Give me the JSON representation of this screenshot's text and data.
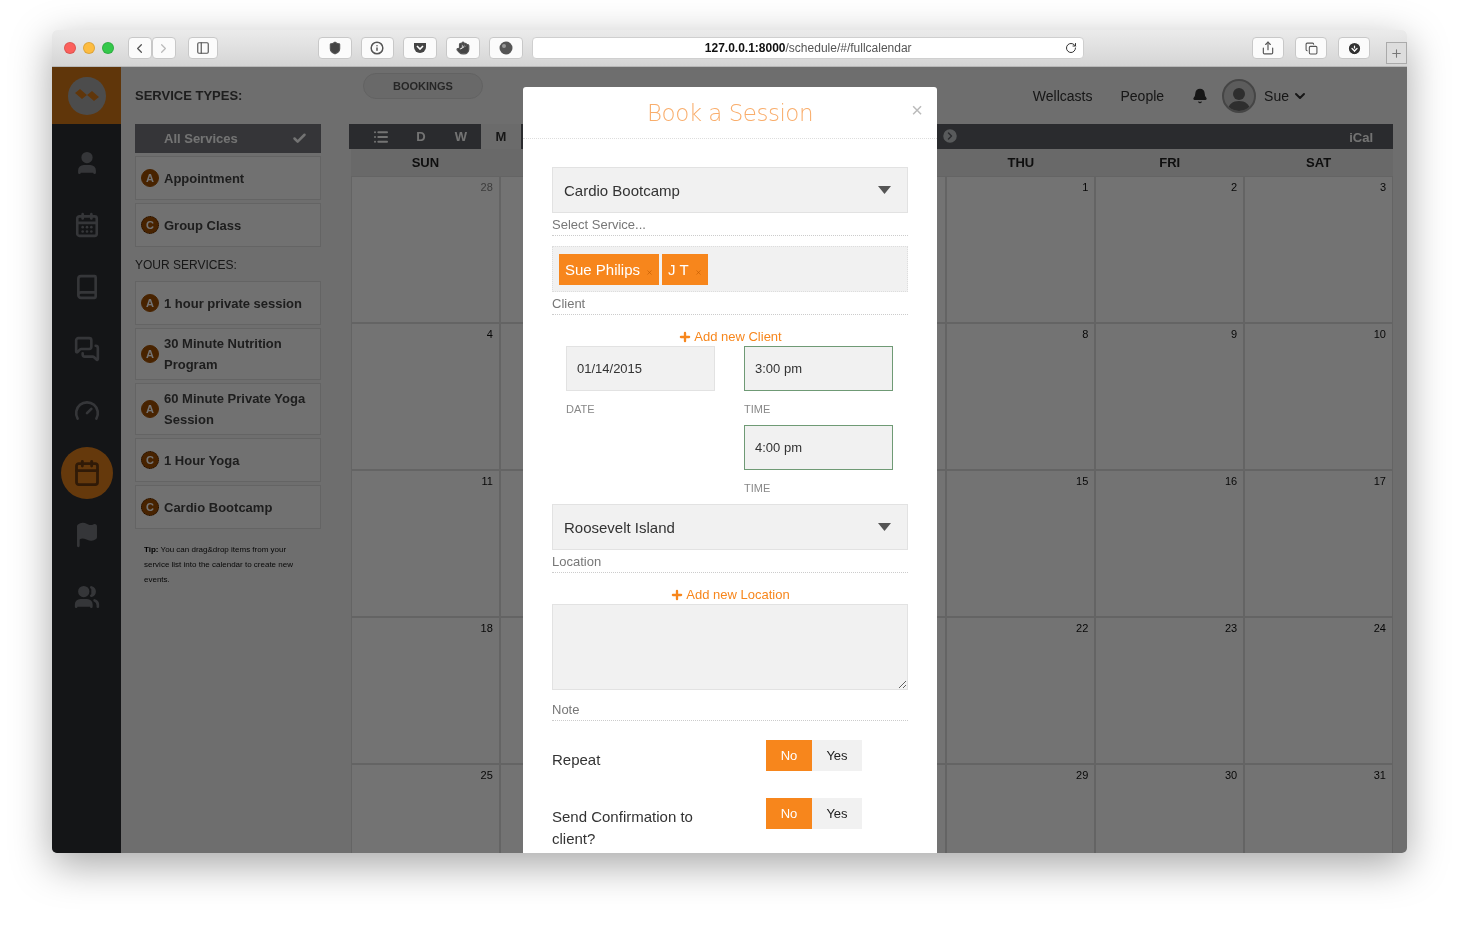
{
  "browser": {
    "url": "**127.0.0.1:8000**/schedule/#/fullcalendar"
  },
  "rail": [
    {
      "kind": "person",
      "selected": false
    },
    {
      "kind": "calendar-wave",
      "selected": false
    },
    {
      "kind": "book",
      "selected": false
    },
    {
      "kind": "chat",
      "selected": false
    },
    {
      "kind": "gauge",
      "selected": false
    },
    {
      "kind": "calendar",
      "selected": true
    },
    {
      "kind": "flag",
      "selected": false
    },
    {
      "kind": "group",
      "selected": false
    }
  ],
  "top_bar": {
    "heading": "SERVICE TYPES:",
    "bookings_button": "BOOKINGS",
    "links": [
      "Wellcasts",
      "People"
    ],
    "user": "Sue"
  },
  "service_types": [
    {
      "kind": "all",
      "label": "All Services",
      "selected": true
    },
    {
      "kind": "appointment",
      "badge": "A",
      "label": "Appointment",
      "selected": false
    },
    {
      "kind": "class",
      "badge": "C",
      "label": "Group Class",
      "selected": false
    }
  ],
  "your_services": {
    "heading": "YOUR SERVICES:",
    "items": [
      {
        "kind": "appointment",
        "badge": "A",
        "label": "1 hour private session"
      },
      {
        "kind": "appointment",
        "badge": "A",
        "label": "30 Minute Nutrition Program"
      },
      {
        "kind": "appointment",
        "badge": "A",
        "label": "60 Minute Private Yoga Session"
      },
      {
        "kind": "class",
        "badge": "C",
        "label": "1 Hour Yoga"
      },
      {
        "kind": "class",
        "badge": "C",
        "label": "Cardio Bootcamp"
      }
    ]
  },
  "tip": "**Tip:** You can drag&drop items from your service list into the calendar to create new events.",
  "calendar": {
    "views": [
      {
        "kind": "list",
        "selected": false
      },
      {
        "kind": "text",
        "label": "D",
        "selected": false
      },
      {
        "kind": "text",
        "label": "W",
        "selected": false
      },
      {
        "kind": "text",
        "label": "M",
        "selected": true
      }
    ],
    "ical": "iCal",
    "columns": [
      {
        "kind": "day",
        "header": "SUN",
        "dates": [
          {
            "label": "28",
            "other_month": true
          },
          {
            "label": "4",
            "other_month": false
          },
          {
            "label": "11",
            "other_month": false
          },
          {
            "label": "18",
            "other_month": false
          },
          {
            "label": "25",
            "other_month": false
          }
        ]
      },
      {
        "kind": "partial"
      },
      {
        "kind": "covered"
      },
      {
        "kind": "partial"
      },
      {
        "kind": "day",
        "header": "THU",
        "dates": [
          {
            "label": "1",
            "other_month": false
          },
          {
            "label": "8",
            "other_month": false
          },
          {
            "label": "15",
            "other_month": false
          },
          {
            "label": "22",
            "other_month": false
          },
          {
            "label": "29",
            "other_month": false
          }
        ]
      },
      {
        "kind": "day",
        "header": "FRI",
        "dates": [
          {
            "label": "2",
            "other_month": false
          },
          {
            "label": "9",
            "other_month": false
          },
          {
            "label": "16",
            "other_month": false
          },
          {
            "label": "23",
            "other_month": false
          },
          {
            "label": "30",
            "other_month": false
          }
        ]
      },
      {
        "kind": "day",
        "header": "SAT",
        "dates": [
          {
            "label": "3",
            "other_month": false
          },
          {
            "label": "10",
            "other_month": false
          },
          {
            "label": "17",
            "other_month": false
          },
          {
            "label": "24",
            "other_month": false
          },
          {
            "label": "31",
            "other_month": false
          }
        ]
      }
    ]
  },
  "modal": {
    "title": "Book a Session",
    "close": "×",
    "service": {
      "value": "Cardio Bootcamp",
      "label": "Select Service..."
    },
    "clients": {
      "tags": [
        "Sue Philips",
        "J T"
      ],
      "label": "Client",
      "add_link": "Add new Client"
    },
    "date": {
      "value": "01/14/2015",
      "label": "DATE"
    },
    "start_time": {
      "value": "3:00 pm",
      "label": "TIME"
    },
    "end_time": {
      "value": "4:00 pm",
      "label": "TIME"
    },
    "location": {
      "value": "Roosevelt Island",
      "label": "Location",
      "add_link": "Add new Location"
    },
    "note": {
      "label": "Note"
    },
    "toggles": [
      {
        "label": "Repeat",
        "options": [
          {
            "label": "No",
            "selected": true
          },
          {
            "label": "Yes",
            "selected": false
          }
        ]
      },
      {
        "label": "Send Confirmation to client?",
        "options": [
          {
            "label": "No",
            "selected": true
          },
          {
            "label": "Yes",
            "selected": false
          }
        ]
      }
    ]
  }
}
